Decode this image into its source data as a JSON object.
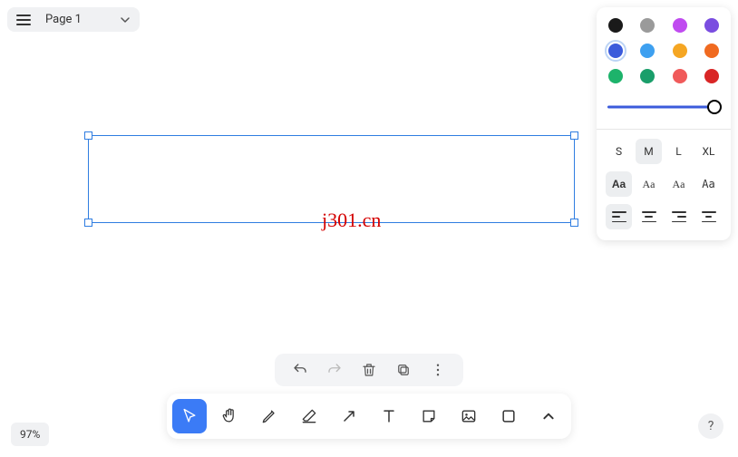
{
  "header": {
    "page_label": "Page 1"
  },
  "watermark": "j301.cn",
  "zoom": "97%",
  "help_label": "?",
  "props": {
    "colors": [
      {
        "hex": "#1a1a1a",
        "selected": false
      },
      {
        "hex": "#9a9a9a",
        "selected": false
      },
      {
        "hex": "#c04bf0",
        "selected": false
      },
      {
        "hex": "#7a4de0",
        "selected": false
      },
      {
        "hex": "#3b5bdb",
        "selected": true
      },
      {
        "hex": "#3ea0f0",
        "selected": false
      },
      {
        "hex": "#f5a623",
        "selected": false
      },
      {
        "hex": "#f06a20",
        "selected": false
      },
      {
        "hex": "#1db36b",
        "selected": false
      },
      {
        "hex": "#1a9e6a",
        "selected": false
      },
      {
        "hex": "#f05a5a",
        "selected": false
      },
      {
        "hex": "#d92626",
        "selected": false
      }
    ],
    "sizes": [
      "S",
      "M",
      "L",
      "XL"
    ],
    "size_selected": 1,
    "fonts": [
      "Aa",
      "Aa",
      "Aa",
      "Aa"
    ],
    "font_selected": 0
  }
}
